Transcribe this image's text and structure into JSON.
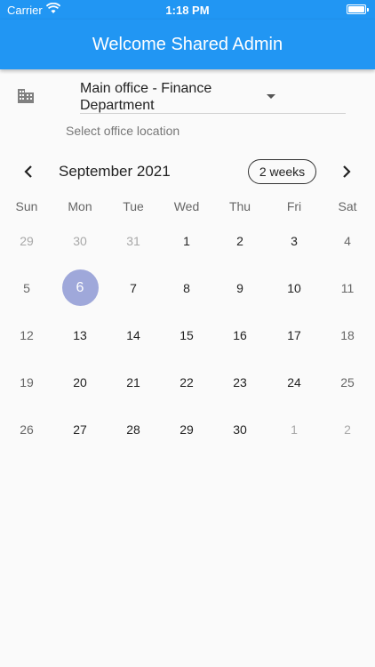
{
  "status_bar": {
    "carrier": "Carrier",
    "time": "1:18 PM"
  },
  "app_bar": {
    "title": "Welcome Shared Admin"
  },
  "location": {
    "value": "Main office - Finance Department",
    "helper": "Select office location",
    "icon": "building-icon"
  },
  "calendar": {
    "month_label": "September 2021",
    "format_button": "2 weeks",
    "weekdays": [
      "Sun",
      "Mon",
      "Tue",
      "Wed",
      "Thu",
      "Fri",
      "Sat"
    ],
    "weeks": [
      [
        "29",
        "30",
        "31",
        "1",
        "2",
        "3",
        "4"
      ],
      [
        "5",
        "6",
        "7",
        "8",
        "9",
        "10",
        "11"
      ],
      [
        "12",
        "13",
        "14",
        "15",
        "16",
        "17",
        "18"
      ],
      [
        "19",
        "20",
        "21",
        "22",
        "23",
        "24",
        "25"
      ],
      [
        "26",
        "27",
        "28",
        "29",
        "30",
        "1",
        "2"
      ]
    ],
    "selected_day": "6",
    "accent_color": "#2196f3",
    "selected_color": "#9fa8da"
  }
}
